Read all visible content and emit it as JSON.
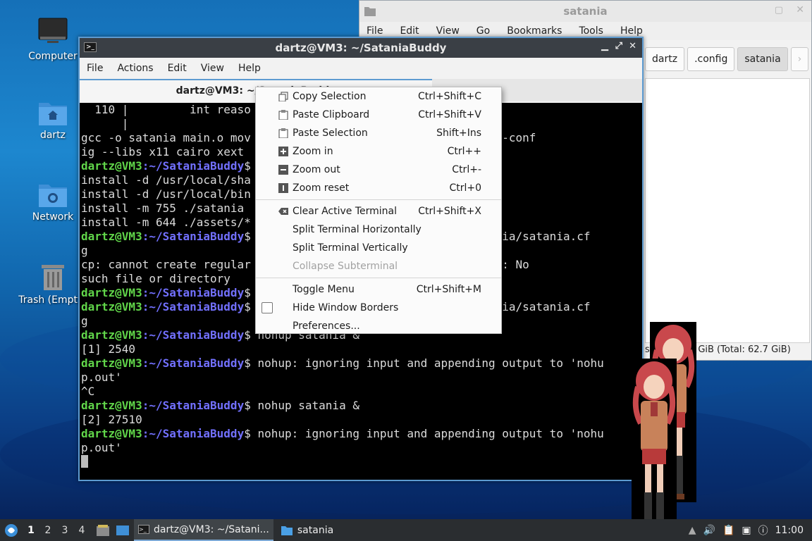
{
  "desktop": {
    "icons": [
      {
        "label": "Computer"
      },
      {
        "label": "dartz"
      },
      {
        "label": "Network"
      },
      {
        "label": "Trash (Empty)"
      }
    ]
  },
  "file_manager": {
    "title": "satania",
    "menu": [
      "File",
      "Edit",
      "View",
      "Go",
      "Bookmarks",
      "Tools",
      "Help"
    ],
    "path": [
      "dartz",
      ".config",
      "satania"
    ],
    "status_visible": "s",
    "status_total": "3 GiB (Total: 62.7 GiB)"
  },
  "terminal": {
    "title": "dartz@VM3: ~/SataniaBuddy",
    "menu": [
      "File",
      "Actions",
      "Edit",
      "View",
      "Help"
    ],
    "tab_title": "dartz@VM3: ~/SataniaBuddy",
    "prompt_user": "dartz@VM3",
    "prompt_dir": ":~/SataniaBuddy",
    "lines": [
      {
        "t": "plain",
        "text": "  110 |         int reaso"
      },
      {
        "t": "plain",
        "text": "      |"
      },
      {
        "t": "plain",
        "text": "gcc -o satania main.o mov                         .o -lXm `pkg-conf"
      },
      {
        "t": "plain",
        "text": "ig --libs x11 cairo xext"
      },
      {
        "t": "prompt",
        "text": "$"
      },
      {
        "t": "plain",
        "text": "install -d /usr/local/sha"
      },
      {
        "t": "plain",
        "text": "install -d /usr/local/bin"
      },
      {
        "t": "plain",
        "text": "install -m 755 ./satania"
      },
      {
        "t": "plain",
        "text": "install -m 644 ./assets/*                               s"
      },
      {
        "t": "prompt",
        "text": "$                                 atania/satania.cf"
      },
      {
        "t": "plain",
        "text": "g"
      },
      {
        "t": "plain",
        "text": "cp: cannot create regular                         satania.cfg': No"
      },
      {
        "t": "plain",
        "text": "such file or directory"
      },
      {
        "t": "prompt",
        "text": "$"
      },
      {
        "t": "prompt",
        "text": "$                                 atania/satania.cf"
      },
      {
        "t": "plain",
        "text": "g"
      },
      {
        "t": "prompt",
        "text": "$ nohup satania &"
      },
      {
        "t": "plain",
        "text": "[1] 2540"
      },
      {
        "t": "prompt",
        "text": "$ nohup: ignoring input and appending output to 'nohu"
      },
      {
        "t": "plain",
        "text": "p.out'"
      },
      {
        "t": "plain",
        "text": "^C"
      },
      {
        "t": "prompt",
        "text": "$ nohup satania &"
      },
      {
        "t": "plain",
        "text": "[2] 27510"
      },
      {
        "t": "prompt",
        "text": "$ nohup: ignoring input and appending output to 'nohu"
      },
      {
        "t": "plain",
        "text": "p.out'"
      }
    ]
  },
  "context_menu": {
    "groups": [
      [
        {
          "label": "Copy Selection",
          "shortcut": "Ctrl+Shift+C",
          "icon": "copy-icon"
        },
        {
          "label": "Paste Clipboard",
          "shortcut": "Ctrl+Shift+V",
          "icon": "paste-icon"
        },
        {
          "label": "Paste Selection",
          "shortcut": "Shift+Ins",
          "icon": "paste-icon"
        },
        {
          "label": "Zoom in",
          "shortcut": "Ctrl++",
          "icon": "zoom-in-icon"
        },
        {
          "label": "Zoom out",
          "shortcut": "Ctrl+-",
          "icon": "zoom-out-icon"
        },
        {
          "label": "Zoom reset",
          "shortcut": "Ctrl+0",
          "icon": "zoom-reset-icon"
        }
      ],
      [
        {
          "label": "Clear Active Terminal",
          "shortcut": "Ctrl+Shift+X",
          "icon": "clear-icon"
        },
        {
          "label": "Split Terminal Horizontally",
          "shortcut": ""
        },
        {
          "label": "Split Terminal Vertically",
          "shortcut": ""
        },
        {
          "label": "Collapse Subterminal",
          "shortcut": "",
          "disabled": true
        }
      ],
      [
        {
          "label": "Toggle Menu",
          "shortcut": "Ctrl+Shift+M"
        },
        {
          "label": "Hide Window Borders",
          "shortcut": "",
          "checkbox": true
        },
        {
          "label": "Preferences...",
          "shortcut": ""
        }
      ]
    ]
  },
  "taskbar": {
    "workspaces": [
      "1",
      "2",
      "3",
      "4"
    ],
    "tasks": [
      {
        "label": "dartz@VM3: ~/Satani...",
        "active": true
      },
      {
        "label": "satania",
        "active": false
      }
    ],
    "clock": "11:00"
  }
}
